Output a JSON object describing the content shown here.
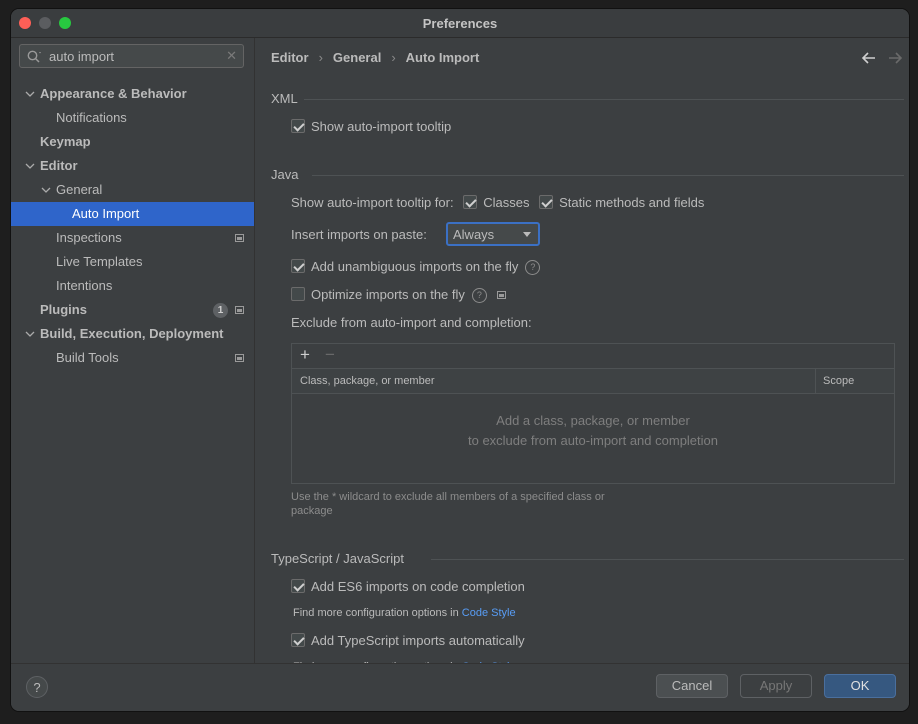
{
  "window": {
    "title": "Preferences"
  },
  "sidebar": {
    "search_value": "auto import",
    "items": [
      {
        "label": "Appearance & Behavior",
        "bold": true,
        "expanded": true
      },
      {
        "label": "Notifications"
      },
      {
        "label": "Keymap",
        "bold": true
      },
      {
        "label": "Editor",
        "bold": true,
        "expanded": true
      },
      {
        "label": "General",
        "expanded": true
      },
      {
        "label": "Auto Import",
        "selected": true
      },
      {
        "label": "Inspections"
      },
      {
        "label": "Live Templates"
      },
      {
        "label": "Intentions"
      },
      {
        "label": "Plugins",
        "bold": true,
        "badge": "1"
      },
      {
        "label": "Build, Execution, Deployment",
        "bold": true,
        "expanded": true
      },
      {
        "label": "Build Tools"
      }
    ]
  },
  "breadcrumb": [
    "Editor",
    "General",
    "Auto Import"
  ],
  "xml": {
    "title": "XML",
    "show_tooltip_label": "Show auto-import tooltip"
  },
  "java": {
    "title": "Java",
    "tooltip_for_label": "Show auto-import tooltip for:",
    "classes_label": "Classes",
    "static_label": "Static methods and fields",
    "insert_on_paste_label": "Insert imports on paste:",
    "insert_on_paste_value": "Always",
    "unambiguous_label": "Add unambiguous imports on the fly",
    "optimize_label": "Optimize imports on the fly",
    "exclude_label": "Exclude from auto-import and completion:",
    "table": {
      "col1": "Class, package, or member",
      "col2": "Scope",
      "empty_line1": "Add a class, package, or member",
      "empty_line2": "to exclude from auto-import and completion"
    },
    "hint_line1": "Use the * wildcard to exclude all members of a specified class or",
    "hint_line2": "package"
  },
  "ts": {
    "title": "TypeScript / JavaScript",
    "es6_label": "Add ES6 imports on code completion",
    "more_text": "Find more configuration options in",
    "code_style_link": "Code Style",
    "ts_auto_label": "Add TypeScript imports automatically"
  },
  "footer": {
    "help": "?",
    "cancel": "Cancel",
    "apply": "Apply",
    "ok": "OK"
  },
  "colors": {
    "selection": "#2f65ca",
    "ok_button": "#365880",
    "link": "#589df6"
  }
}
